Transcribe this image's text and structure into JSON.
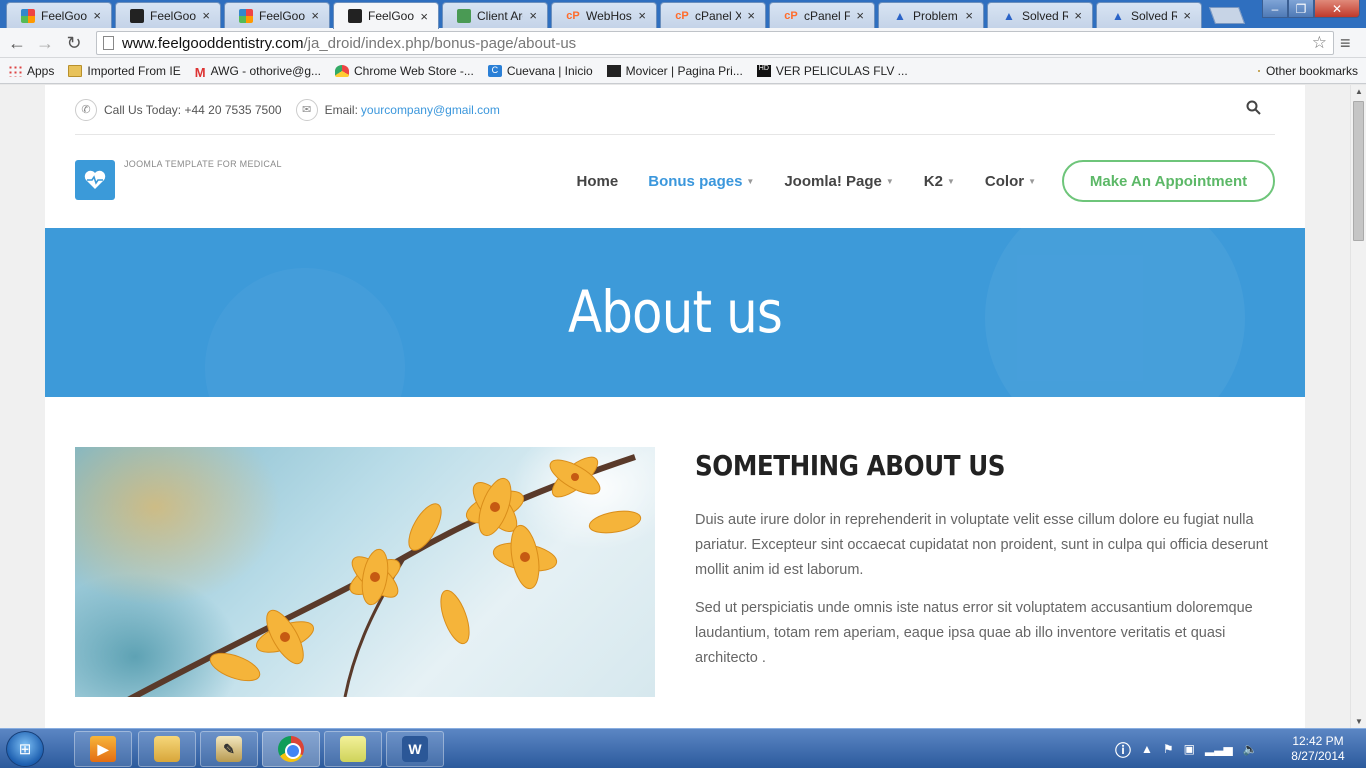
{
  "browser": {
    "tabs": [
      {
        "title": "FeelGoodD",
        "favicon": "joomla-icon"
      },
      {
        "title": "FeelGoodD",
        "favicon": "joomla-dark-icon"
      },
      {
        "title": "FeelGood",
        "favicon": "joomla-icon"
      },
      {
        "title": "FeelGood",
        "favicon": "joomla-dark-icon",
        "active": true
      },
      {
        "title": "Client Are",
        "favicon": "client-area-icon"
      },
      {
        "title": "WebHost I",
        "favicon": "cpanel-icon"
      },
      {
        "title": "cPanel X -",
        "favicon": "cpanel-icon"
      },
      {
        "title": "cPanel File",
        "favicon": "cpanel-icon"
      },
      {
        "title": "Problem R",
        "favicon": "triangle-icon"
      },
      {
        "title": "Solved Re",
        "favicon": "triangle-icon"
      },
      {
        "title": "Solved Re",
        "favicon": "triangle-icon"
      }
    ],
    "tab_close": "×",
    "url_host": "www.feelgooddentistry.com",
    "url_path": "/ja_droid/index.php/bonus-page/about-us",
    "bookmarks": [
      {
        "label": "Apps",
        "icon": "apps-grid-icon"
      },
      {
        "label": "Imported From IE",
        "icon": "folder-icon"
      },
      {
        "label": "AWG - othorive@g...",
        "icon": "gmail-icon"
      },
      {
        "label": "Chrome Web Store -...",
        "icon": "web-store-icon"
      },
      {
        "label": "Cuevana | Inicio",
        "icon": "cuevana-icon"
      },
      {
        "label": "Movicer | Pagina Pri...",
        "icon": "movicer-icon"
      },
      {
        "label": "VER PELICULAS FLV ...",
        "icon": "hd-icon"
      }
    ],
    "other_bookmarks": "Other bookmarks"
  },
  "site": {
    "topbar": {
      "call_label": "Call Us Today: +44 20 7535 7500",
      "email_label": "Email:",
      "email_value": "yourcompany@gmail.com"
    },
    "tagline": "JOOMLA TEMPLATE FOR MEDICAL",
    "nav": [
      {
        "label": "Home",
        "active": false,
        "caret": false
      },
      {
        "label": "Bonus pages",
        "active": true,
        "caret": true
      },
      {
        "label": "Joomla! Page",
        "active": false,
        "caret": true
      },
      {
        "label": "K2",
        "active": false,
        "caret": true
      },
      {
        "label": "Color",
        "active": false,
        "caret": true
      }
    ],
    "cta": "Make An Appointment",
    "hero_title": "About us",
    "section_title": "SOMETHING ABOUT US",
    "para1": "Duis aute irure dolor in reprehenderit in voluptate velit esse cillum dolore eu fugiat nulla pariatur. Excepteur sint occaecat cupidatat non proident, sunt in culpa qui officia deserunt mollit anim id est laborum.",
    "para2": "Sed ut perspiciatis unde omnis iste natus error sit voluptatem accusantium doloremque laudantium, totam rem aperiam, eaque ipsa quae ab illo inventore veritatis et quasi architecto .",
    "image_icon": "flower-photo",
    "colors": {
      "primary": "#3d9ad9",
      "cta": "#5cb867"
    }
  },
  "taskbar": {
    "apps": [
      "media-center-icon",
      "explorer-icon",
      "paint-icon",
      "chrome-icon",
      "sticky-notes-icon",
      "word-icon"
    ],
    "time": "12:42 PM",
    "date": "8/27/2014"
  }
}
